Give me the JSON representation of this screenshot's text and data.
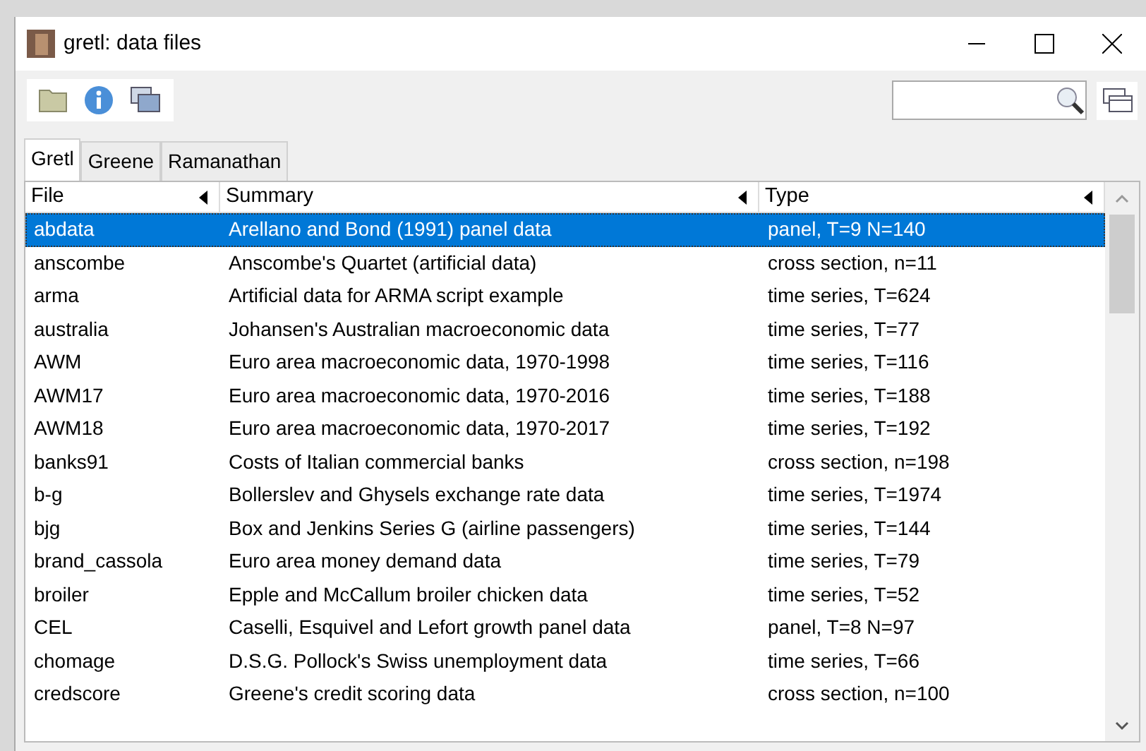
{
  "window": {
    "title": "gretl: data files"
  },
  "tabs": [
    {
      "label": "Gretl",
      "selected": true
    },
    {
      "label": "Greene",
      "selected": false
    },
    {
      "label": "Ramanathan",
      "selected": false
    }
  ],
  "table": {
    "columns": [
      "File",
      "Summary",
      "Type"
    ],
    "rows": [
      {
        "cells": [
          "abdata",
          "Arellano and Bond (1991) panel data",
          "panel, T=9 N=140"
        ],
        "selected": true
      },
      {
        "cells": [
          "anscombe",
          "Anscombe's Quartet (artificial data)",
          "cross section, n=11"
        ],
        "selected": false
      },
      {
        "cells": [
          "arma",
          "Artificial data for ARMA script example",
          "time series, T=624"
        ],
        "selected": false
      },
      {
        "cells": [
          "australia",
          "Johansen's Australian macroeconomic data",
          "time series, T=77"
        ],
        "selected": false
      },
      {
        "cells": [
          "AWM",
          "Euro area macroeconomic data, 1970-1998",
          "time series, T=116"
        ],
        "selected": false
      },
      {
        "cells": [
          "AWM17",
          "Euro area macroeconomic data, 1970-2016",
          "time series, T=188"
        ],
        "selected": false
      },
      {
        "cells": [
          "AWM18",
          "Euro area macroeconomic data, 1970-2017",
          "time series, T=192"
        ],
        "selected": false
      },
      {
        "cells": [
          "banks91",
          "Costs of Italian commercial banks",
          "cross section, n=198"
        ],
        "selected": false
      },
      {
        "cells": [
          "b-g",
          "Bollerslev and Ghysels exchange rate data",
          "time series, T=1974"
        ],
        "selected": false
      },
      {
        "cells": [
          "bjg",
          "Box and Jenkins Series G (airline passengers)",
          "time series, T=144"
        ],
        "selected": false
      },
      {
        "cells": [
          "brand_cassola",
          "Euro area money demand data",
          "time series, T=79"
        ],
        "selected": false
      },
      {
        "cells": [
          "broiler",
          "Epple and McCallum broiler chicken data",
          "time series, T=52"
        ],
        "selected": false
      },
      {
        "cells": [
          "CEL",
          "Caselli, Esquivel and Lefort growth panel data",
          "panel, T=8 N=97"
        ],
        "selected": false
      },
      {
        "cells": [
          "chomage",
          "D.S.G. Pollock's Swiss unemployment data",
          "time series, T=66"
        ],
        "selected": false
      },
      {
        "cells": [
          "credscore",
          "Greene's credit scoring data",
          "cross section, n=100"
        ],
        "selected": false
      }
    ]
  }
}
